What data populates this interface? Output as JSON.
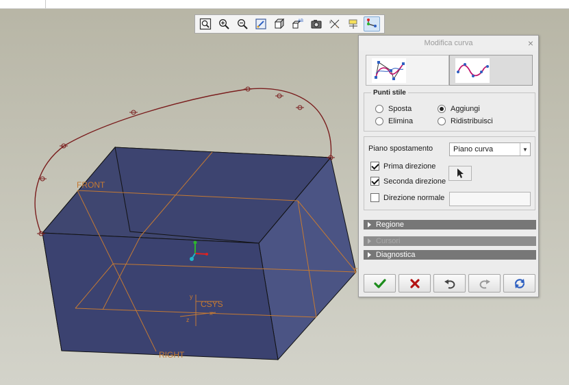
{
  "toolbar": {
    "tools": [
      {
        "name": "refit",
        "icon": "zoom-fit-icon"
      },
      {
        "name": "zoom-in",
        "icon": "zoom-in-icon"
      },
      {
        "name": "zoom-out",
        "icon": "zoom-out-icon"
      },
      {
        "name": "repaint",
        "icon": "repaint-icon"
      },
      {
        "name": "display-style",
        "icon": "cube-display-icon"
      },
      {
        "name": "saved-views",
        "icon": "saved-views-icon"
      },
      {
        "name": "view-manager",
        "icon": "camera-view-icon"
      },
      {
        "name": "datum-display",
        "icon": "datum-axes-icon"
      },
      {
        "name": "annotation-display",
        "icon": "annotation-display-icon"
      },
      {
        "name": "curve-points",
        "icon": "curve-points-icon",
        "active": true
      }
    ]
  },
  "viewport": {
    "datum_labels": {
      "front": "FRONT",
      "right": "RIGHT",
      "top": "T",
      "csys": "CSYS"
    },
    "axis_labels": {
      "y": "y",
      "x": "x",
      "z": "z"
    }
  },
  "dialog": {
    "title": "Modifica curva",
    "close_glyph": "×",
    "mode_buttons": [
      {
        "icon": "control-polygon-curve-icon",
        "selected": false
      },
      {
        "icon": "interpolated-curve-icon",
        "selected": true
      }
    ],
    "punti_stile": {
      "legend": "Punti stile",
      "options": [
        {
          "label": "Sposta",
          "selected": false
        },
        {
          "label": "Aggiungi",
          "selected": true
        },
        {
          "label": "Elimina",
          "selected": false
        },
        {
          "label": "Ridistribuisci",
          "selected": false
        }
      ]
    },
    "piano_spostamento": {
      "label": "Piano spostamento",
      "value": "Piano curva"
    },
    "checkboxes": [
      {
        "label": "Prima direzione",
        "checked": true
      },
      {
        "label": "Seconda direzione",
        "checked": true
      },
      {
        "label": "Direzione normale",
        "checked": false
      }
    ],
    "sections": [
      {
        "label": "Regione",
        "enabled": true
      },
      {
        "label": "Cursori",
        "enabled": false
      },
      {
        "label": "Diagnostica",
        "enabled": true
      }
    ],
    "actions": [
      {
        "name": "ok",
        "icon": "check-icon"
      },
      {
        "name": "cancel",
        "icon": "cancel-x-icon"
      },
      {
        "name": "undo",
        "icon": "undo-icon"
      },
      {
        "name": "redo",
        "icon": "redo-icon"
      },
      {
        "name": "refresh",
        "icon": "refresh-icon"
      }
    ]
  },
  "colors": {
    "box_face": "#424a73",
    "datum_lines": "#c57a33",
    "curve": "#7a1e1e",
    "ok_green": "#1d8d1d",
    "cancel_red": "#b31212",
    "refresh_blue": "#2d5fc1"
  }
}
